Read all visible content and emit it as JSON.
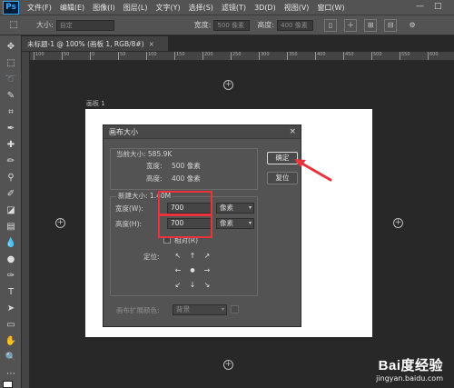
{
  "menubar": {
    "logo": "Ps",
    "items": [
      "文件(F)",
      "编辑(E)",
      "图像(I)",
      "图层(L)",
      "文字(Y)",
      "选择(S)",
      "滤镜(T)",
      "3D(D)",
      "视图(V)",
      "窗口(W)"
    ],
    "window_controls": [
      "—",
      "□"
    ]
  },
  "options": {
    "tool_glyph": "⬚",
    "size_label": "大小:",
    "size_value": "自定",
    "width_label": "宽度:",
    "width_value": "500 像素",
    "height_label": "高度:",
    "height_value": "400 像素"
  },
  "document": {
    "tab_title": "未标题-1 @ 100% (画板 1, RGB/8#)",
    "close_glyph": "×",
    "artboard_label": "画板 1",
    "ruler_labels": [
      "100",
      "50",
      "0",
      "50",
      "100",
      "150",
      "200",
      "250",
      "300",
      "350",
      "400",
      "450",
      "500",
      "550",
      "600",
      "650"
    ]
  },
  "dialog": {
    "title": "画布大小",
    "close_glyph": "×",
    "current_size_label": "当前大小: 585.9K",
    "current_width_label": "宽度:",
    "current_width_value": "500 像素",
    "current_height_label": "高度:",
    "current_height_value": "400 像素",
    "new_size_label": "新建大小: 1.40M",
    "width_label": "宽度(W):",
    "width_value": "700",
    "width_unit": "像素",
    "height_label": "高度(H):",
    "height_value": "700",
    "height_unit": "像素",
    "relative_label": "相对(R)",
    "anchor_label": "定位:",
    "anchor_arrows": [
      "↖",
      "↑",
      "↗",
      "←",
      "●",
      "→",
      "↙",
      "↓",
      "↘"
    ],
    "extension_label": "画布扩展颜色:",
    "extension_value": "背景",
    "ok_label": "确定",
    "reset_label": "复位"
  },
  "watermark": {
    "brand": "Bai度经验",
    "url": "jingyan.baidu.com"
  },
  "colors": {
    "highlight": "#e8333a",
    "panel": "#535353",
    "canvas_bg": "#282828"
  }
}
